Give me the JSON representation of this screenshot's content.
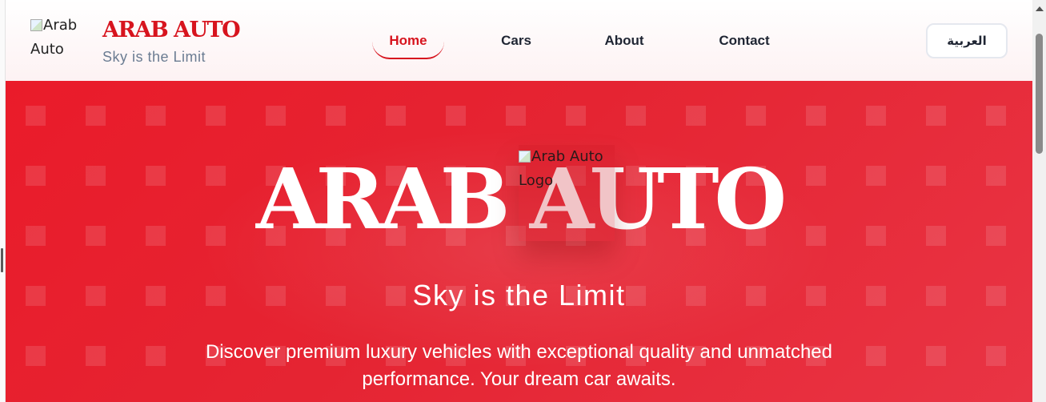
{
  "header": {
    "logo_alt": "Arab Auto",
    "brand_name": "ARAB AUTO",
    "brand_tagline": "Sky is the Limit",
    "nav": [
      {
        "label": "Home",
        "active": true
      },
      {
        "label": "Cars",
        "active": false
      },
      {
        "label": "About",
        "active": false
      },
      {
        "label": "Contact",
        "active": false
      }
    ],
    "language_button": "العربية"
  },
  "hero": {
    "logo_alt": "Arab Auto Logo",
    "title": "ARAB AUTO",
    "subtitle": "Sky is the Limit",
    "description": "Discover premium luxury vehicles with exceptional quality and unmatched performance. Your dream car awaits."
  },
  "colors": {
    "brand_red": "#d7141e",
    "hero_red": "#e52432",
    "nav_text": "#1f2533",
    "tagline_gray": "#6b7c92"
  },
  "icons": {
    "broken_image": "broken-image-icon",
    "scroll_up": "chevron-up-icon"
  }
}
